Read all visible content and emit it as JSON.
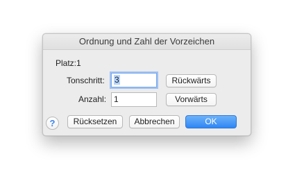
{
  "dialog": {
    "title": "Ordnung und Zahl der Vorzeichen",
    "position_label": "Platz:1",
    "tonschritt": {
      "label": "Tonschritt:",
      "value": "3"
    },
    "anzahl": {
      "label": "Anzahl:",
      "value": "1"
    },
    "buttons": {
      "backward": "Rückwärts",
      "forward": "Vorwärts",
      "reset": "Rücksetzen",
      "cancel": "Abbrechen",
      "ok": "OK"
    },
    "help_icon": "question-mark-icon",
    "help_glyph": "?",
    "colors": {
      "accent": "#2f86f3",
      "focus_ring": "#9ec2f5"
    }
  }
}
